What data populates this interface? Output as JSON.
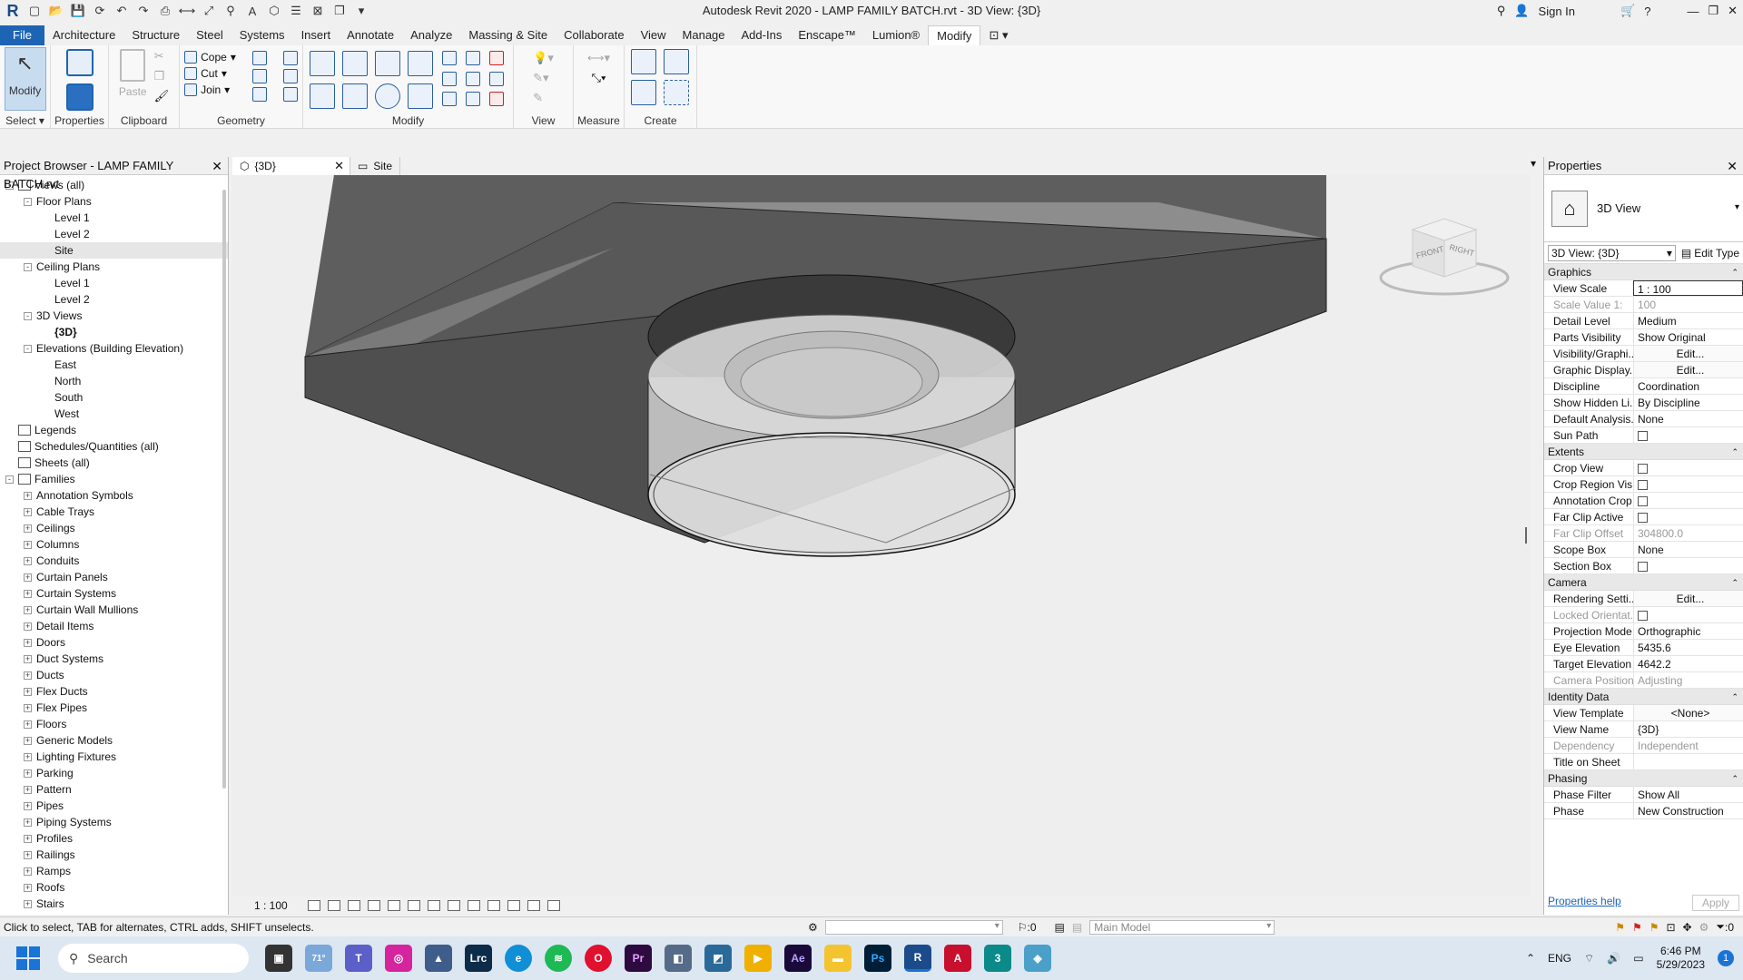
{
  "window": {
    "title": "Autodesk Revit 2020 - LAMP FAMILY BATCH.rvt - 3D View: {3D}",
    "signin": "Sign In"
  },
  "menu": [
    "File",
    "Architecture",
    "Structure",
    "Steel",
    "Systems",
    "Insert",
    "Annotate",
    "Analyze",
    "Massing & Site",
    "Collaborate",
    "View",
    "Manage",
    "Add-Ins",
    "Enscape™",
    "Lumion®",
    "Modify"
  ],
  "ribbon": {
    "select_btn": "Modify",
    "properties_btn": "Properties",
    "paste_btn": "Paste",
    "cope": "Cope",
    "cut": "Cut",
    "join": "Join",
    "panels": {
      "select": "Select",
      "properties": "Properties",
      "clipboard": "Clipboard",
      "geometry": "Geometry",
      "modify": "Modify",
      "view": "View",
      "measure": "Measure",
      "create": "Create"
    }
  },
  "project_browser": {
    "title": "Project Browser - LAMP FAMILY BATCH.rvt",
    "items": [
      {
        "label": "Views (all)",
        "level": 0,
        "toggle": "-",
        "icon": true
      },
      {
        "label": "Floor Plans",
        "level": 1,
        "toggle": "-"
      },
      {
        "label": "Level 1",
        "level": 2
      },
      {
        "label": "Level 2",
        "level": 2
      },
      {
        "label": "Site",
        "level": 2,
        "selected": true
      },
      {
        "label": "Ceiling Plans",
        "level": 1,
        "toggle": "-"
      },
      {
        "label": "Level 1",
        "level": 2
      },
      {
        "label": "Level 2",
        "level": 2
      },
      {
        "label": "3D Views",
        "level": 1,
        "toggle": "-"
      },
      {
        "label": "{3D}",
        "level": 2,
        "bold": true
      },
      {
        "label": "Elevations (Building Elevation)",
        "level": 1,
        "toggle": "-"
      },
      {
        "label": "East",
        "level": 2
      },
      {
        "label": "North",
        "level": 2
      },
      {
        "label": "South",
        "level": 2
      },
      {
        "label": "West",
        "level": 2
      },
      {
        "label": "Legends",
        "level": 0,
        "icon": true
      },
      {
        "label": "Schedules/Quantities (all)",
        "level": 0,
        "icon": true
      },
      {
        "label": "Sheets (all)",
        "level": 0,
        "icon": true
      },
      {
        "label": "Families",
        "level": 0,
        "toggle": "-",
        "icon": true
      },
      {
        "label": "Annotation Symbols",
        "level": 1,
        "toggle": "+"
      },
      {
        "label": "Cable Trays",
        "level": 1,
        "toggle": "+"
      },
      {
        "label": "Ceilings",
        "level": 1,
        "toggle": "+"
      },
      {
        "label": "Columns",
        "level": 1,
        "toggle": "+"
      },
      {
        "label": "Conduits",
        "level": 1,
        "toggle": "+"
      },
      {
        "label": "Curtain Panels",
        "level": 1,
        "toggle": "+"
      },
      {
        "label": "Curtain Systems",
        "level": 1,
        "toggle": "+"
      },
      {
        "label": "Curtain Wall Mullions",
        "level": 1,
        "toggle": "+"
      },
      {
        "label": "Detail Items",
        "level": 1,
        "toggle": "+"
      },
      {
        "label": "Doors",
        "level": 1,
        "toggle": "+"
      },
      {
        "label": "Duct Systems",
        "level": 1,
        "toggle": "+"
      },
      {
        "label": "Ducts",
        "level": 1,
        "toggle": "+"
      },
      {
        "label": "Flex Ducts",
        "level": 1,
        "toggle": "+"
      },
      {
        "label": "Flex Pipes",
        "level": 1,
        "toggle": "+"
      },
      {
        "label": "Floors",
        "level": 1,
        "toggle": "+"
      },
      {
        "label": "Generic Models",
        "level": 1,
        "toggle": "+"
      },
      {
        "label": "Lighting Fixtures",
        "level": 1,
        "toggle": "+"
      },
      {
        "label": "Parking",
        "level": 1,
        "toggle": "+"
      },
      {
        "label": "Pattern",
        "level": 1,
        "toggle": "+"
      },
      {
        "label": "Pipes",
        "level": 1,
        "toggle": "+"
      },
      {
        "label": "Piping Systems",
        "level": 1,
        "toggle": "+"
      },
      {
        "label": "Profiles",
        "level": 1,
        "toggle": "+"
      },
      {
        "label": "Railings",
        "level": 1,
        "toggle": "+"
      },
      {
        "label": "Ramps",
        "level": 1,
        "toggle": "+"
      },
      {
        "label": "Roofs",
        "level": 1,
        "toggle": "+"
      },
      {
        "label": "Stairs",
        "level": 1,
        "toggle": "+"
      }
    ]
  },
  "tabs": [
    {
      "label": "{3D}",
      "active": true
    },
    {
      "label": "Site",
      "active": false
    }
  ],
  "viewcube": {
    "front": "FRONT",
    "right": "RIGHT"
  },
  "view_scale_bar": "1 : 100",
  "properties": {
    "title": "Properties",
    "type_name": "3D View",
    "selector": "3D View: {3D}",
    "edit_type": "Edit Type",
    "groups": [
      {
        "name": "Graphics",
        "rows": [
          {
            "k": "View Scale",
            "v": "1 : 100",
            "style": "input"
          },
          {
            "k": "Scale Value    1:",
            "v": "100",
            "dim": true
          },
          {
            "k": "Detail Level",
            "v": "Medium"
          },
          {
            "k": "Parts Visibility",
            "v": "Show Original"
          },
          {
            "k": "Visibility/Graphi...",
            "v": "Edit...",
            "style": "btn"
          },
          {
            "k": "Graphic Display...",
            "v": "Edit...",
            "style": "btn"
          },
          {
            "k": "Discipline",
            "v": "Coordination"
          },
          {
            "k": "Show Hidden Li...",
            "v": "By Discipline"
          },
          {
            "k": "Default Analysis...",
            "v": "None"
          },
          {
            "k": "Sun Path",
            "v": "",
            "style": "check"
          }
        ]
      },
      {
        "name": "Extents",
        "rows": [
          {
            "k": "Crop View",
            "v": "",
            "style": "check"
          },
          {
            "k": "Crop Region Vis...",
            "v": "",
            "style": "check"
          },
          {
            "k": "Annotation Crop",
            "v": "",
            "style": "check"
          },
          {
            "k": "Far Clip Active",
            "v": "",
            "style": "check"
          },
          {
            "k": "Far Clip Offset",
            "v": "304800.0",
            "dim": true
          },
          {
            "k": "Scope Box",
            "v": "None"
          },
          {
            "k": "Section Box",
            "v": "",
            "style": "check"
          }
        ]
      },
      {
        "name": "Camera",
        "rows": [
          {
            "k": "Rendering Setti...",
            "v": "Edit...",
            "style": "btn"
          },
          {
            "k": "Locked Orientat...",
            "v": "",
            "style": "check",
            "dim": true
          },
          {
            "k": "Projection Mode",
            "v": "Orthographic"
          },
          {
            "k": "Eye Elevation",
            "v": "5435.6"
          },
          {
            "k": "Target Elevation",
            "v": "4642.2"
          },
          {
            "k": "Camera Position",
            "v": "Adjusting",
            "dim": true
          }
        ]
      },
      {
        "name": "Identity Data",
        "rows": [
          {
            "k": "View Template",
            "v": "<None>",
            "style": "btn"
          },
          {
            "k": "View Name",
            "v": "{3D}"
          },
          {
            "k": "Dependency",
            "v": "Independent",
            "dim": true
          },
          {
            "k": "Title on Sheet",
            "v": ""
          }
        ]
      },
      {
        "name": "Phasing",
        "rows": [
          {
            "k": "Phase Filter",
            "v": "Show All"
          },
          {
            "k": "Phase",
            "v": "New Construction"
          }
        ]
      }
    ],
    "help": "Properties help",
    "apply": "Apply"
  },
  "status": {
    "hint": "Click to select, TAB for alternates, CTRL adds, SHIFT unselects.",
    "counter": ":0",
    "model": "Main Model",
    "filter_count": ":0"
  },
  "taskbar": {
    "search": "Search",
    "weather": "71°",
    "lang": "ENG",
    "time": "6:46 PM",
    "date": "5/29/2023",
    "notif": "1"
  }
}
